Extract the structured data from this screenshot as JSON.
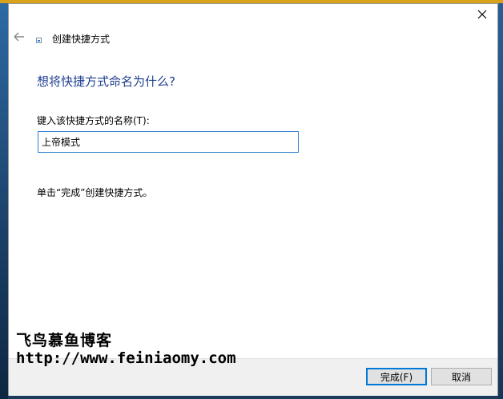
{
  "colors": {
    "heading": "#1e3e8f",
    "input_border": "#2f7fcc",
    "accent": "#0078d7"
  },
  "titlebar": {
    "close_glyph": "✕",
    "close_icon": "close-icon"
  },
  "wizard": {
    "back_icon": "back-arrow-icon",
    "title": "创建快捷方式",
    "heading": "想将快捷方式命名为什么?",
    "field_label": "键入该快捷方式的名称(T):",
    "name_value": "上帝模式",
    "hint": "单击“完成”创建快捷方式。"
  },
  "watermark": {
    "line1": "飞鸟慕鱼博客",
    "line2": "http://www.feiniaomy.com"
  },
  "buttons": {
    "finish": "完成(F)",
    "cancel": "取消"
  }
}
